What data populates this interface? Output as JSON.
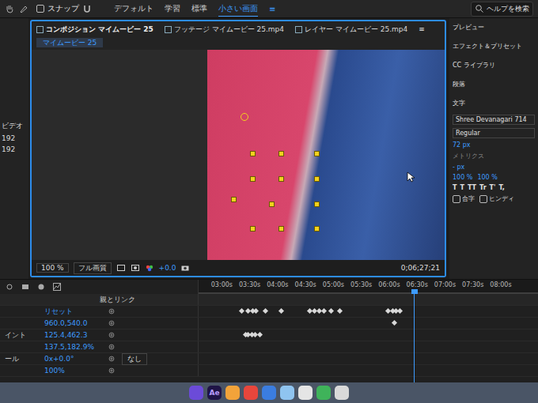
{
  "toolbar": {
    "snap": "スナップ",
    "workspaces": [
      {
        "label": "デフォルト",
        "selected": false
      },
      {
        "label": "学習",
        "selected": false
      },
      {
        "label": "標準",
        "selected": false
      },
      {
        "label": "小さい画面",
        "selected": true
      }
    ],
    "menu": "≡",
    "search": "ヘルプを検索"
  },
  "left_panel": {
    "label": "ビデオ",
    "values": [
      "192",
      "192"
    ]
  },
  "tabs": [
    {
      "label": "コンポジション マイムービー 25",
      "selected": true
    },
    {
      "label": "フッテージ マイムービー 25.mp4",
      "selected": false
    },
    {
      "label": "レイヤー マイムービー 25.mp4",
      "selected": false
    }
  ],
  "tab_menu": "≡",
  "breadcrumb": "マイムービー 25",
  "viewer_footer": {
    "zoom": "100 %",
    "quality": "フル画質",
    "exposure": "+0.0",
    "timecode": "0;06;27;21"
  },
  "right_panel": {
    "items": [
      "プレビュー",
      "エフェクト＆プリセット",
      "CC ライブラリ",
      "段落",
      "文字"
    ],
    "font": "Shree Devanagari 714",
    "style": "Regular",
    "size": "72 px",
    "kerning": "メトリクス",
    "leading": "- px",
    "scales": [
      "100 %",
      "100 %"
    ],
    "styles": [
      "T",
      "T",
      "TT",
      "Tr",
      "T'",
      "T,"
    ],
    "checkboxes": [
      {
        "label": "合字",
        "checked": false
      },
      {
        "label": "ヒンディ",
        "checked": false
      }
    ]
  },
  "timeline": {
    "ruler": [
      "03:00s",
      "03:30s",
      "04:00s",
      "04:30s",
      "05:00s",
      "05:30s",
      "06:00s",
      "06:30s",
      "07:00s",
      "07:30s",
      "08:00s"
    ],
    "playhead_seconds": 387,
    "parent_header": "親とリンク",
    "parent_value": "なし",
    "properties": [
      {
        "name": "",
        "value": "リセット",
        "keyframes": [
          202,
          209,
          214,
          217,
          227,
          244,
          275,
          280,
          285,
          290,
          298,
          307,
          359,
          364,
          368,
          372
        ]
      },
      {
        "name": "",
        "value": "960.0,540.0",
        "keyframes": [
          366
        ]
      },
      {
        "name": "イント",
        "value": "125.4,462.3",
        "keyframes": [
          206,
          209,
          213,
          216,
          221
        ]
      },
      {
        "name": "",
        "value": "137.5,182.9%",
        "keyframes": []
      },
      {
        "name": "ール",
        "value": "0x+0.0°",
        "keyframes": []
      },
      {
        "name": "",
        "value": "100%",
        "keyframes": []
      }
    ]
  },
  "dock": [
    {
      "label": "",
      "color": "#6b4bd8"
    },
    {
      "label": "Ae",
      "color": "#1f1446"
    },
    {
      "label": "",
      "color": "#f2a33a"
    },
    {
      "label": "",
      "color": "#e8463c"
    },
    {
      "label": "",
      "color": "#3b7de0"
    },
    {
      "label": "",
      "color": "#8fc4f0"
    },
    {
      "label": "",
      "color": "#e5e5e5"
    },
    {
      "label": "",
      "color": "#3fb35a"
    },
    {
      "label": "",
      "color": "#d9d9d9"
    }
  ]
}
